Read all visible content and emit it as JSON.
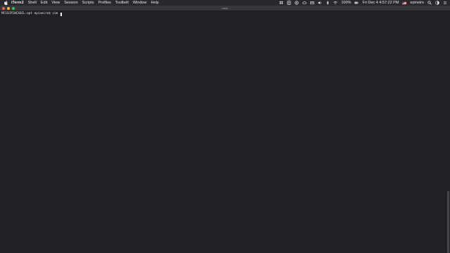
{
  "menubar": {
    "app_name": "iTerm2",
    "items": [
      "Shell",
      "Edit",
      "View",
      "Session",
      "Scripts",
      "Profiles",
      "Toolbelt",
      "Window",
      "Help"
    ],
    "battery": "100%",
    "datetime": "Fri Dec 4  4:57:22 PM",
    "user": "epineiro",
    "icons": [
      "apple-icon",
      "dropbox-icon",
      "script-icon",
      "display-icon",
      "cloud-icon",
      "volume-icon",
      "bluetooth-icon",
      "wifi-icon",
      "battery-icon",
      "flag-icon",
      "search-icon",
      "control-center-icon",
      "menu-icon"
    ]
  },
  "window": {
    "title": "bash"
  },
  "terminal": {
    "prompt": "MF1SCPIWCXOIL:opt epineiro$ vim "
  },
  "colors": {
    "background": "#231f27",
    "menubar": "#2a282c",
    "titlebar": "#3a373c",
    "close": "#ff5f57",
    "minimize": "#febc2e",
    "maximize": "#28c840"
  }
}
